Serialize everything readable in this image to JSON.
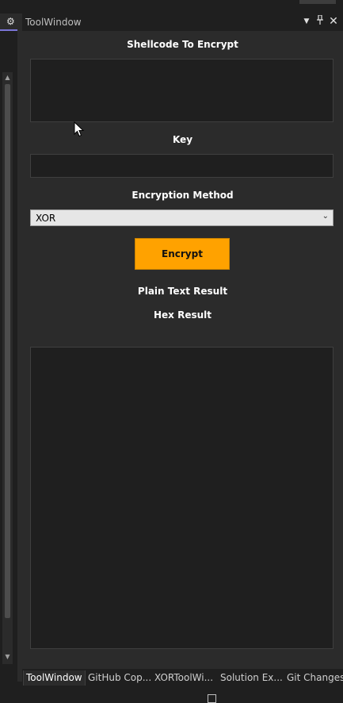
{
  "toolwindow": {
    "title": "ToolWindow",
    "shellcode_label": "Shellcode To Encrypt",
    "shellcode_value": "",
    "key_label": "Key",
    "key_value": "",
    "method_label": "Encryption Method",
    "method_selected": "XOR",
    "encrypt_label": "Encrypt",
    "plain_result_label": "Plain Text Result",
    "hex_result_label": "Hex Result",
    "result_value": ""
  },
  "bottom_tabs": [
    {
      "label": "ToolWindow",
      "active": true
    },
    {
      "label": "GitHub Cop..."
    },
    {
      "label": "XORToolWi..."
    },
    {
      "label": "Solution Ex..."
    },
    {
      "label": "Git Changes"
    }
  ],
  "colors": {
    "accent_button": "#ffa200",
    "panel_bg": "#2b2b2b",
    "field_bg": "#1f1f1f",
    "active_indicator": "#7a75d6"
  },
  "icons": [
    "gear-icon",
    "window-menu-icon",
    "pin-icon",
    "close-icon",
    "chevron-down-icon",
    "scroll-up-icon",
    "scroll-down-icon",
    "mouse-cursor-icon"
  ]
}
